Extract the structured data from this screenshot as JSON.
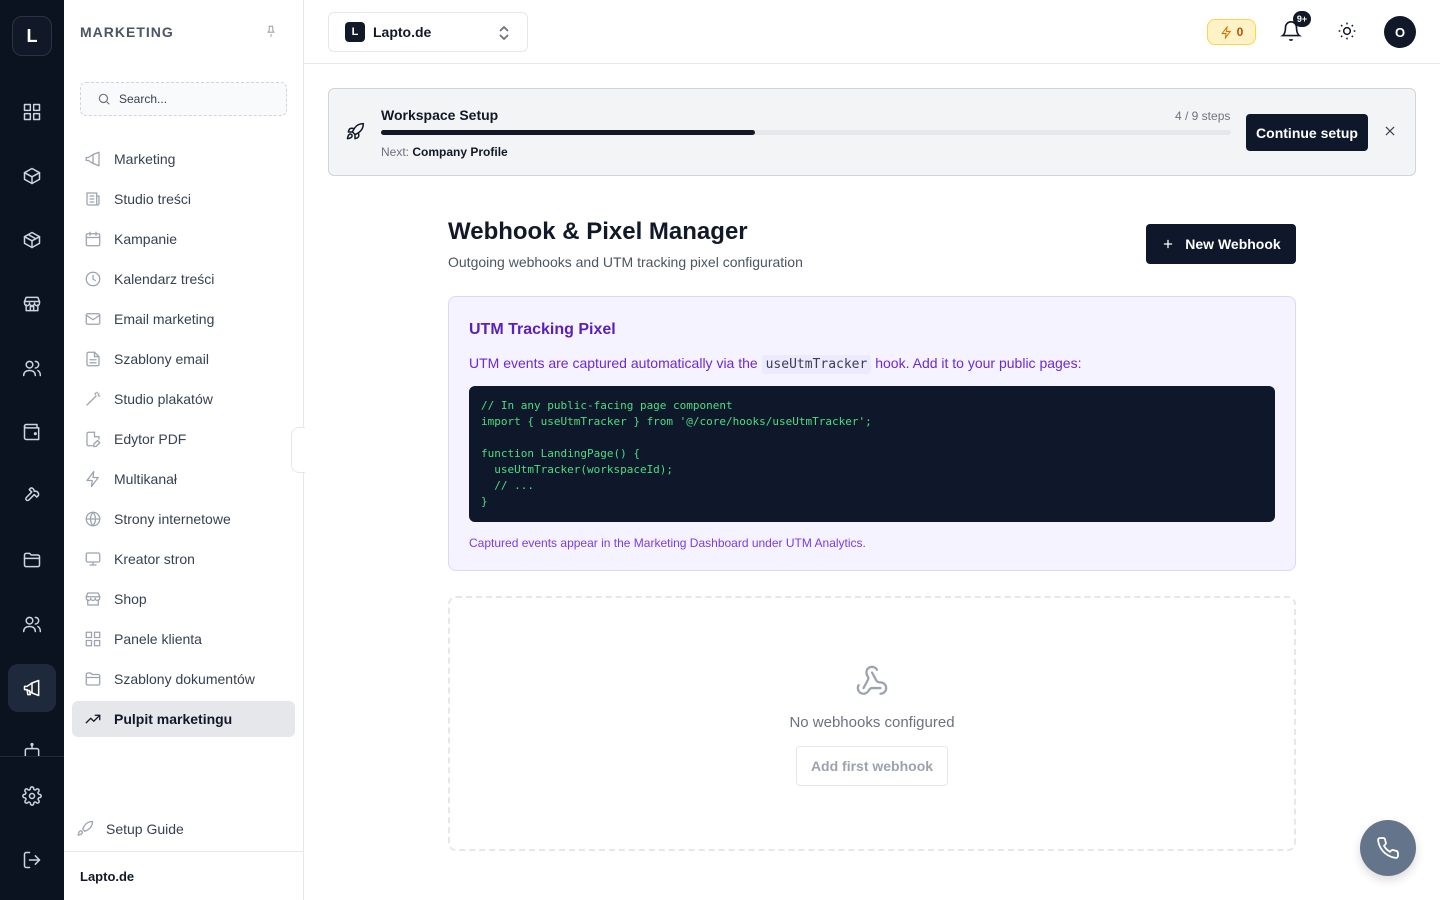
{
  "rail": {
    "logo": "L",
    "items": [
      {
        "icon": "grid-icon"
      },
      {
        "icon": "box-icon"
      },
      {
        "icon": "box-icon"
      },
      {
        "icon": "store-icon"
      },
      {
        "icon": "users-icon"
      },
      {
        "icon": "wallet-icon"
      },
      {
        "icon": "wrench-icon"
      },
      {
        "icon": "folder-icon"
      },
      {
        "icon": "users-icon"
      },
      {
        "icon": "megaphone-icon",
        "active": true
      },
      {
        "icon": "robot-icon"
      }
    ],
    "bottom": [
      {
        "icon": "gear-icon"
      },
      {
        "icon": "logout-icon"
      }
    ]
  },
  "sidebar": {
    "title": "MARKETING",
    "search_placeholder": "Search...",
    "items": [
      {
        "label": "Marketing",
        "icon": "megaphone-icon"
      },
      {
        "label": "Studio treści",
        "icon": "newspaper-icon"
      },
      {
        "label": "Kampanie",
        "icon": "calendar-icon"
      },
      {
        "label": "Kalendarz treści",
        "icon": "clock-icon"
      },
      {
        "label": "Email marketing",
        "icon": "mail-icon"
      },
      {
        "label": "Szablony email",
        "icon": "file-text-icon"
      },
      {
        "label": "Studio plakatów",
        "icon": "wand-icon"
      },
      {
        "label": "Edytor PDF",
        "icon": "file-edit-icon"
      },
      {
        "label": "Multikanał",
        "icon": "zap-icon"
      },
      {
        "label": "Strony internetowe",
        "icon": "globe-icon"
      },
      {
        "label": "Kreator stron",
        "icon": "monitor-icon"
      },
      {
        "label": "Shop",
        "icon": "store-icon"
      },
      {
        "label": "Panele klienta",
        "icon": "grid-icon"
      },
      {
        "label": "Szablony dokumentów",
        "icon": "folder-icon"
      },
      {
        "label": "Pulpit marketingu",
        "icon": "trending-up-icon",
        "active": true
      }
    ],
    "setup_guide": "Setup Guide",
    "footer": "Lapto.de"
  },
  "topbar": {
    "workspace_badge": "L",
    "workspace_name": "Lapto.de",
    "credits": "0",
    "notifications_badge": "9+",
    "avatar": "O"
  },
  "setup_banner": {
    "title": "Workspace Setup",
    "steps": "4 / 9 steps",
    "progress": 0.44,
    "next_label": "Next:",
    "next_value": "Company Profile",
    "button": "Continue setup"
  },
  "page": {
    "title": "Webhook & Pixel Manager",
    "subtitle": "Outgoing webhooks and UTM tracking pixel configuration",
    "new_button": "New Webhook"
  },
  "utm": {
    "title": "UTM Tracking Pixel",
    "desc_before": "UTM events are captured automatically via the",
    "desc_code": "useUtmTracker",
    "desc_after": "hook. Add it to your public pages:",
    "code": "// In any public-facing page component\nimport { useUtmTracker } from '@/core/hooks/useUtmTracker';\n\nfunction LandingPage() {\n  useUtmTracker(workspaceId);\n  // ...\n}",
    "note": "Captured events appear in the Marketing Dashboard under UTM Analytics."
  },
  "empty": {
    "text": "No webhooks configured",
    "button": "Add first webhook"
  },
  "colors": {
    "rail_bg": "#0b1220",
    "primary": "#0f172a",
    "utm_accent": "#6d28d9",
    "code_green": "#4ade80"
  }
}
